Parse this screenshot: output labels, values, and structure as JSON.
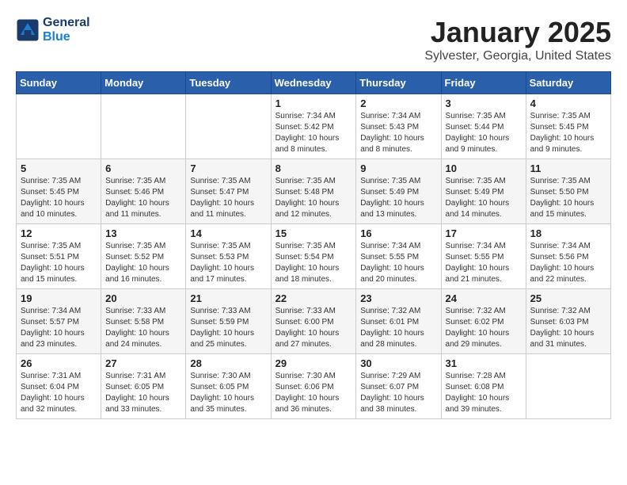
{
  "header": {
    "logo_line1": "General",
    "logo_line2": "Blue",
    "month": "January 2025",
    "location": "Sylvester, Georgia, United States"
  },
  "weekdays": [
    "Sunday",
    "Monday",
    "Tuesday",
    "Wednesday",
    "Thursday",
    "Friday",
    "Saturday"
  ],
  "weeks": [
    [
      {
        "day": "",
        "info": ""
      },
      {
        "day": "",
        "info": ""
      },
      {
        "day": "",
        "info": ""
      },
      {
        "day": "1",
        "info": "Sunrise: 7:34 AM\nSunset: 5:42 PM\nDaylight: 10 hours\nand 8 minutes."
      },
      {
        "day": "2",
        "info": "Sunrise: 7:34 AM\nSunset: 5:43 PM\nDaylight: 10 hours\nand 8 minutes."
      },
      {
        "day": "3",
        "info": "Sunrise: 7:35 AM\nSunset: 5:44 PM\nDaylight: 10 hours\nand 9 minutes."
      },
      {
        "day": "4",
        "info": "Sunrise: 7:35 AM\nSunset: 5:45 PM\nDaylight: 10 hours\nand 9 minutes."
      }
    ],
    [
      {
        "day": "5",
        "info": "Sunrise: 7:35 AM\nSunset: 5:45 PM\nDaylight: 10 hours\nand 10 minutes."
      },
      {
        "day": "6",
        "info": "Sunrise: 7:35 AM\nSunset: 5:46 PM\nDaylight: 10 hours\nand 11 minutes."
      },
      {
        "day": "7",
        "info": "Sunrise: 7:35 AM\nSunset: 5:47 PM\nDaylight: 10 hours\nand 11 minutes."
      },
      {
        "day": "8",
        "info": "Sunrise: 7:35 AM\nSunset: 5:48 PM\nDaylight: 10 hours\nand 12 minutes."
      },
      {
        "day": "9",
        "info": "Sunrise: 7:35 AM\nSunset: 5:49 PM\nDaylight: 10 hours\nand 13 minutes."
      },
      {
        "day": "10",
        "info": "Sunrise: 7:35 AM\nSunset: 5:49 PM\nDaylight: 10 hours\nand 14 minutes."
      },
      {
        "day": "11",
        "info": "Sunrise: 7:35 AM\nSunset: 5:50 PM\nDaylight: 10 hours\nand 15 minutes."
      }
    ],
    [
      {
        "day": "12",
        "info": "Sunrise: 7:35 AM\nSunset: 5:51 PM\nDaylight: 10 hours\nand 15 minutes."
      },
      {
        "day": "13",
        "info": "Sunrise: 7:35 AM\nSunset: 5:52 PM\nDaylight: 10 hours\nand 16 minutes."
      },
      {
        "day": "14",
        "info": "Sunrise: 7:35 AM\nSunset: 5:53 PM\nDaylight: 10 hours\nand 17 minutes."
      },
      {
        "day": "15",
        "info": "Sunrise: 7:35 AM\nSunset: 5:54 PM\nDaylight: 10 hours\nand 18 minutes."
      },
      {
        "day": "16",
        "info": "Sunrise: 7:34 AM\nSunset: 5:55 PM\nDaylight: 10 hours\nand 20 minutes."
      },
      {
        "day": "17",
        "info": "Sunrise: 7:34 AM\nSunset: 5:55 PM\nDaylight: 10 hours\nand 21 minutes."
      },
      {
        "day": "18",
        "info": "Sunrise: 7:34 AM\nSunset: 5:56 PM\nDaylight: 10 hours\nand 22 minutes."
      }
    ],
    [
      {
        "day": "19",
        "info": "Sunrise: 7:34 AM\nSunset: 5:57 PM\nDaylight: 10 hours\nand 23 minutes."
      },
      {
        "day": "20",
        "info": "Sunrise: 7:33 AM\nSunset: 5:58 PM\nDaylight: 10 hours\nand 24 minutes."
      },
      {
        "day": "21",
        "info": "Sunrise: 7:33 AM\nSunset: 5:59 PM\nDaylight: 10 hours\nand 25 minutes."
      },
      {
        "day": "22",
        "info": "Sunrise: 7:33 AM\nSunset: 6:00 PM\nDaylight: 10 hours\nand 27 minutes."
      },
      {
        "day": "23",
        "info": "Sunrise: 7:32 AM\nSunset: 6:01 PM\nDaylight: 10 hours\nand 28 minutes."
      },
      {
        "day": "24",
        "info": "Sunrise: 7:32 AM\nSunset: 6:02 PM\nDaylight: 10 hours\nand 29 minutes."
      },
      {
        "day": "25",
        "info": "Sunrise: 7:32 AM\nSunset: 6:03 PM\nDaylight: 10 hours\nand 31 minutes."
      }
    ],
    [
      {
        "day": "26",
        "info": "Sunrise: 7:31 AM\nSunset: 6:04 PM\nDaylight: 10 hours\nand 32 minutes."
      },
      {
        "day": "27",
        "info": "Sunrise: 7:31 AM\nSunset: 6:05 PM\nDaylight: 10 hours\nand 33 minutes."
      },
      {
        "day": "28",
        "info": "Sunrise: 7:30 AM\nSunset: 6:05 PM\nDaylight: 10 hours\nand 35 minutes."
      },
      {
        "day": "29",
        "info": "Sunrise: 7:30 AM\nSunset: 6:06 PM\nDaylight: 10 hours\nand 36 minutes."
      },
      {
        "day": "30",
        "info": "Sunrise: 7:29 AM\nSunset: 6:07 PM\nDaylight: 10 hours\nand 38 minutes."
      },
      {
        "day": "31",
        "info": "Sunrise: 7:28 AM\nSunset: 6:08 PM\nDaylight: 10 hours\nand 39 minutes."
      },
      {
        "day": "",
        "info": ""
      }
    ]
  ]
}
